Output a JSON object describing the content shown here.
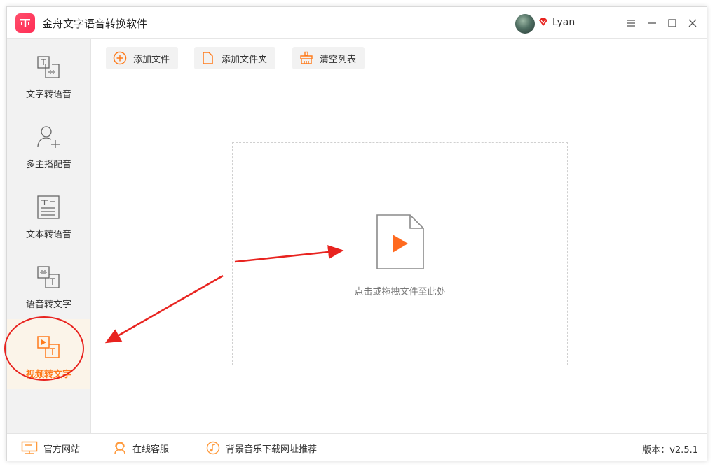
{
  "app": {
    "title": "金舟文字语音转换软件"
  },
  "user": {
    "name": "Lyan"
  },
  "sidebar": {
    "items": [
      {
        "label": "文字转语音"
      },
      {
        "label": "多主播配音"
      },
      {
        "label": "文本转语音"
      },
      {
        "label": "语音转文字"
      },
      {
        "label": "视频转文字",
        "active": true
      }
    ]
  },
  "toolbar": {
    "add_file": "添加文件",
    "add_folder": "添加文件夹",
    "clear_list": "清空列表"
  },
  "dropzone": {
    "hint": "点击或拖拽文件至此处"
  },
  "statusbar": {
    "website": "官方网站",
    "support": "在线客服",
    "music": "背景音乐下载网址推荐",
    "version": "版本：v2.5.1"
  },
  "colors": {
    "accent": "#ff7a1a",
    "annotation": "#e8231f",
    "brand": "#ff2d55"
  },
  "icons": [
    "app-logo-icon",
    "vip-icon",
    "menu-icon",
    "minimize-icon",
    "maximize-icon",
    "close-icon",
    "text-to-speech-icon",
    "multi-voice-icon",
    "document-to-speech-icon",
    "speech-to-text-icon",
    "video-to-text-icon",
    "add-circle-icon",
    "folder-icon",
    "broom-icon",
    "video-file-icon",
    "monitor-icon",
    "headset-user-icon",
    "music-note-icon"
  ]
}
